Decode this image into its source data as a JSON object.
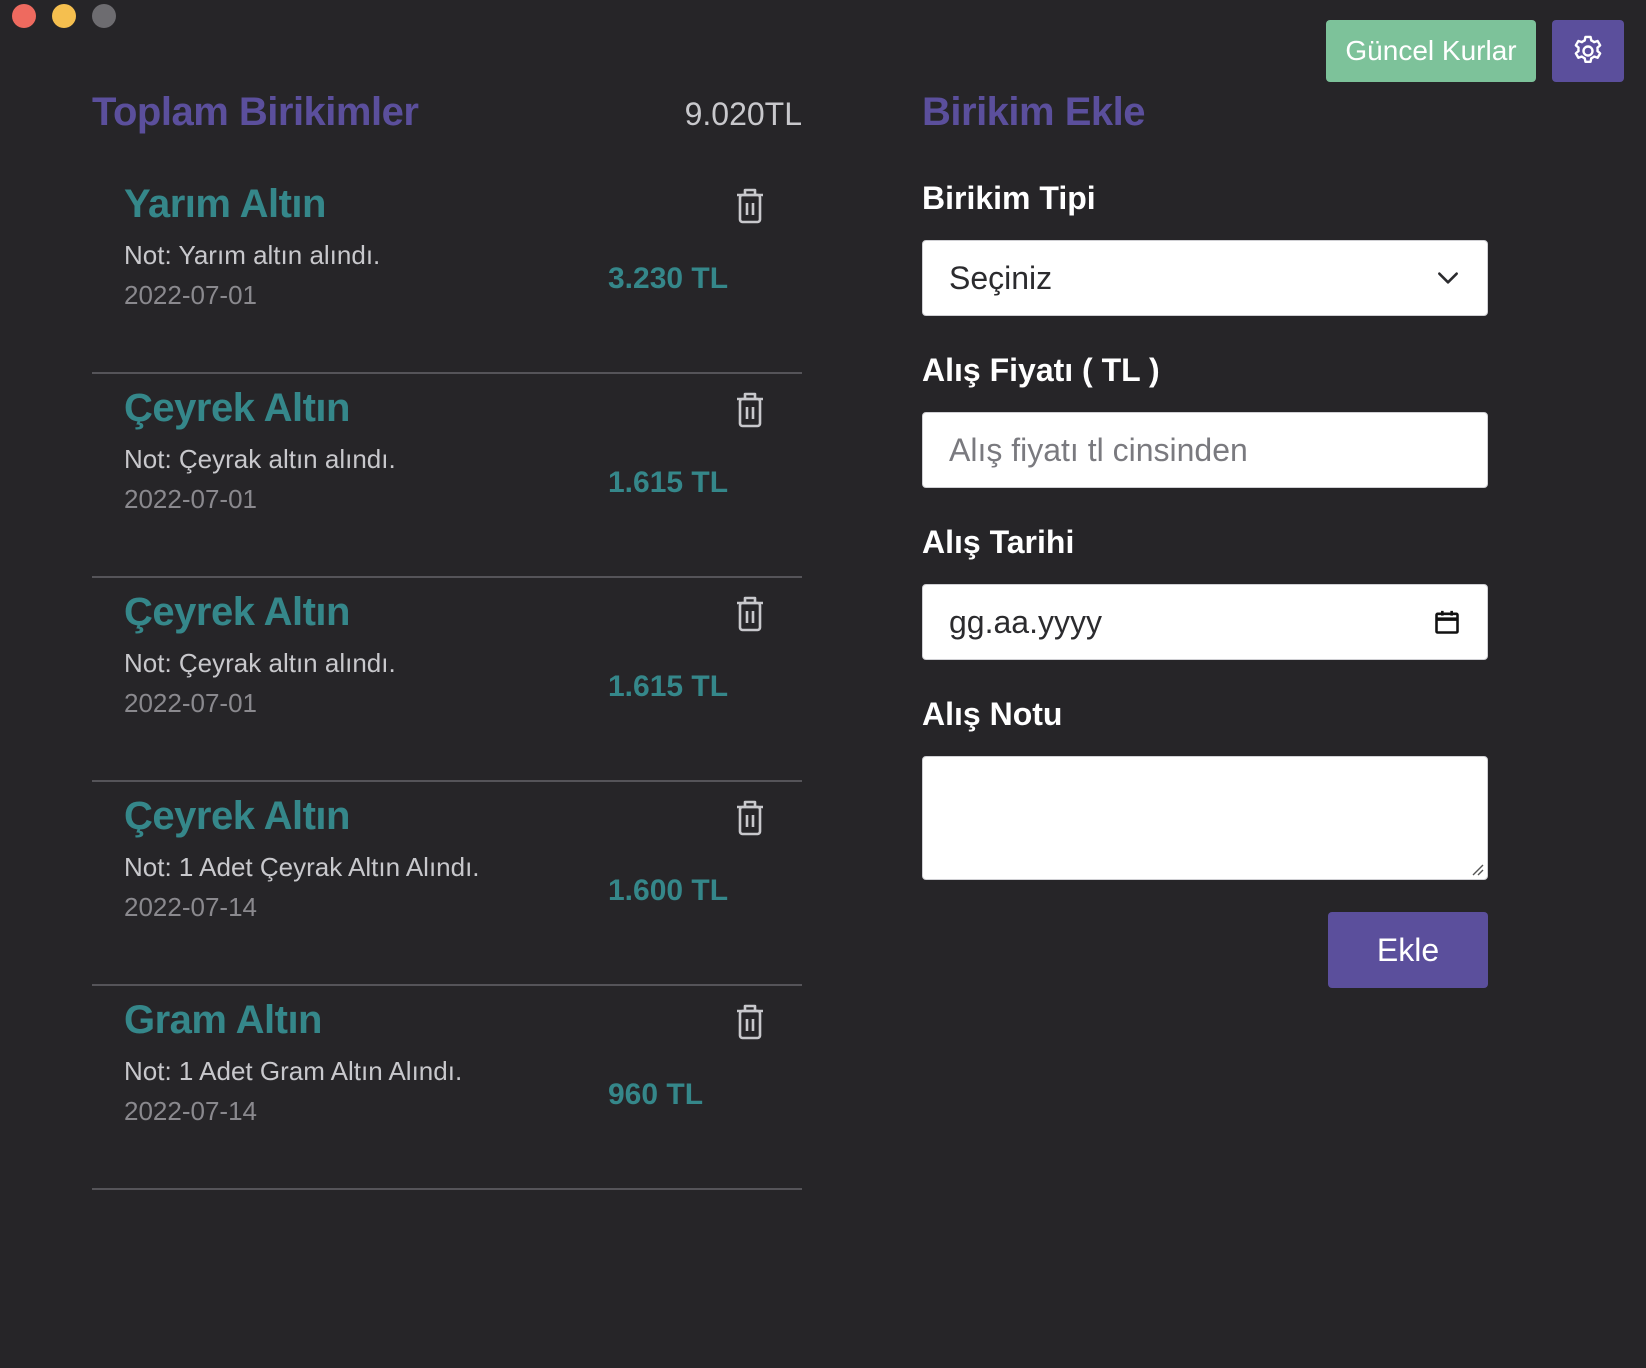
{
  "window": {
    "controls": [
      "close",
      "minimize",
      "maximize"
    ]
  },
  "header": {
    "rates_button": "Güncel Kurlar",
    "settings_icon": "gear-icon"
  },
  "savings": {
    "title": "Toplam Birikimler",
    "total": "9.020TL",
    "items": [
      {
        "title": "Yarım Altın",
        "note": "Not: Yarım altın alındı.",
        "date": "2022-07-01",
        "amount": "3.230 TL"
      },
      {
        "title": "Çeyrek Altın",
        "note": "Not: Çeyrak altın alındı.",
        "date": "2022-07-01",
        "amount": "1.615 TL"
      },
      {
        "title": "Çeyrek Altın",
        "note": "Not: Çeyrak altın alındı.",
        "date": "2022-07-01",
        "amount": "1.615 TL"
      },
      {
        "title": "Çeyrek Altın",
        "note": "Not: 1 Adet Çeyrak Altın Alındı.",
        "date": "2022-07-14",
        "amount": "1.600 TL"
      },
      {
        "title": "Gram Altın",
        "note": "Not: 1 Adet Gram Altın Alındı.",
        "date": "2022-07-14",
        "amount": "960 TL"
      }
    ]
  },
  "form": {
    "title": "Birikim Ekle",
    "type_label": "Birikim Tipi",
    "type_value": "Seçiniz",
    "price_label": "Alış Fiyatı ( TL )",
    "price_placeholder": "Alış fiyatı tl cinsinden",
    "date_label": "Alış Tarihi",
    "date_value": "gg.aa.yyyy",
    "note_label": "Alış Notu",
    "note_value": "",
    "submit": "Ekle"
  },
  "colors": {
    "background": "#262528",
    "accent_purple": "#5b4f9c",
    "accent_teal": "#35878a",
    "accent_green": "#7dc29a"
  }
}
